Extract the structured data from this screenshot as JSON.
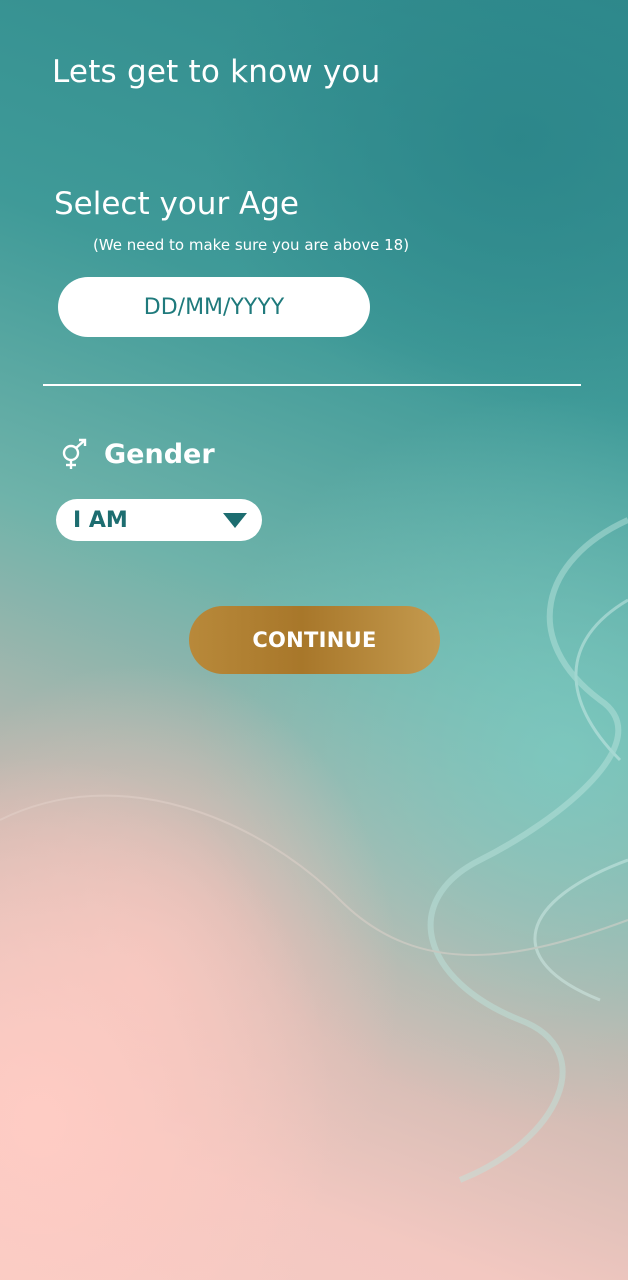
{
  "header": {
    "title": "Lets get to know you"
  },
  "age": {
    "heading": "Select your Age",
    "note": "(We need to make sure you are above 18)",
    "date_placeholder": "DD/MM/YYYY"
  },
  "gender": {
    "icon": "gender-symbol-icon",
    "label": "Gender",
    "selected_value": "I AM"
  },
  "actions": {
    "continue_label": "CONTINUE"
  },
  "colors": {
    "accent_teal": "#1f7a7c",
    "button_gold": "#b8893a"
  }
}
